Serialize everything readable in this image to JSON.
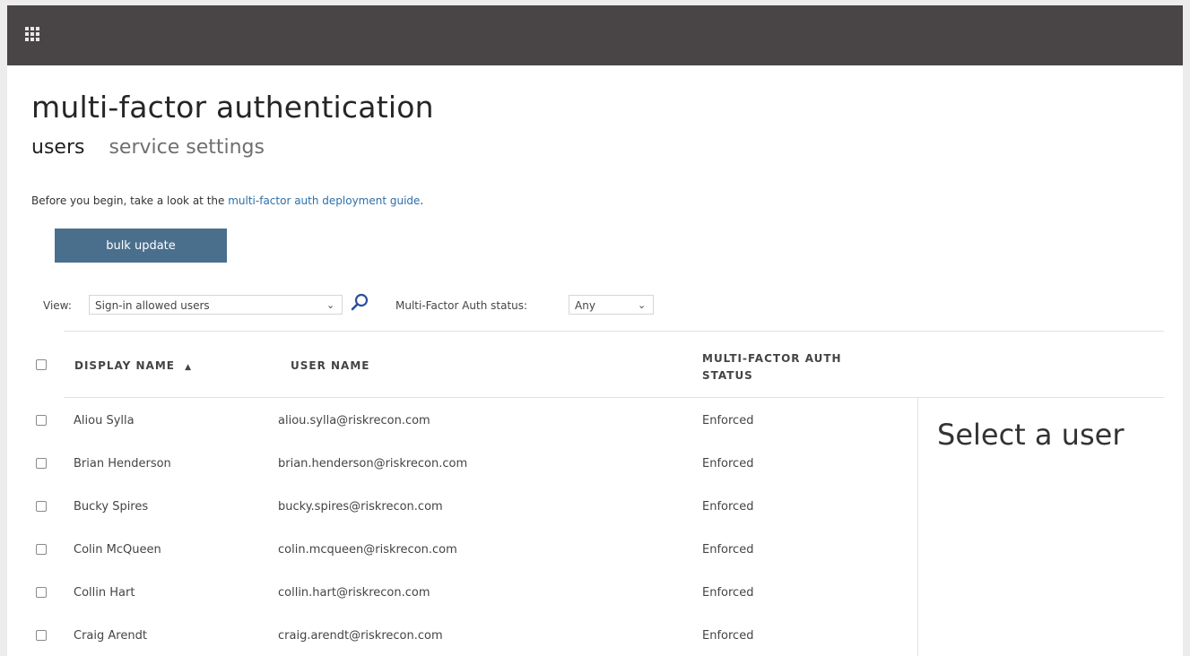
{
  "header": {
    "app_launcher_icon": "waffle-grid-icon"
  },
  "page": {
    "title": "multi-factor authentication",
    "tabs": [
      {
        "label": "users",
        "active": true
      },
      {
        "label": "service settings",
        "active": false
      }
    ],
    "intro_text": "Before you begin, take a look at the ",
    "intro_link": "multi-factor auth deployment guide",
    "intro_suffix": ".",
    "bulk_update_label": "bulk update"
  },
  "filters": {
    "view_label": "View:",
    "view_value": "Sign-in allowed users",
    "search_icon": "search-icon",
    "status_label": "Multi-Factor Auth status:",
    "status_value": "Any"
  },
  "table": {
    "columns": {
      "display_name": "DISPLAY NAME",
      "display_name_sort": "▲",
      "user_name": "USER NAME",
      "status_line1": "MULTI-FACTOR AUTH",
      "status_line2": "STATUS"
    },
    "rows": [
      {
        "display_name": "Aliou Sylla",
        "user_name": "aliou.sylla@riskrecon.com",
        "status": "Enforced"
      },
      {
        "display_name": "Brian Henderson",
        "user_name": "brian.henderson@riskrecon.com",
        "status": "Enforced"
      },
      {
        "display_name": "Bucky Spires",
        "user_name": "bucky.spires@riskrecon.com",
        "status": "Enforced"
      },
      {
        "display_name": "Colin McQueen",
        "user_name": "colin.mcqueen@riskrecon.com",
        "status": "Enforced"
      },
      {
        "display_name": "Collin Hart",
        "user_name": "collin.hart@riskrecon.com",
        "status": "Enforced"
      },
      {
        "display_name": "Craig Arendt",
        "user_name": "craig.arendt@riskrecon.com",
        "status": "Enforced"
      }
    ]
  },
  "details_panel": {
    "placeholder": "Select a user"
  },
  "colors": {
    "topbar": "#494445",
    "button": "#4a6f8d",
    "link": "#2e6fa8"
  }
}
